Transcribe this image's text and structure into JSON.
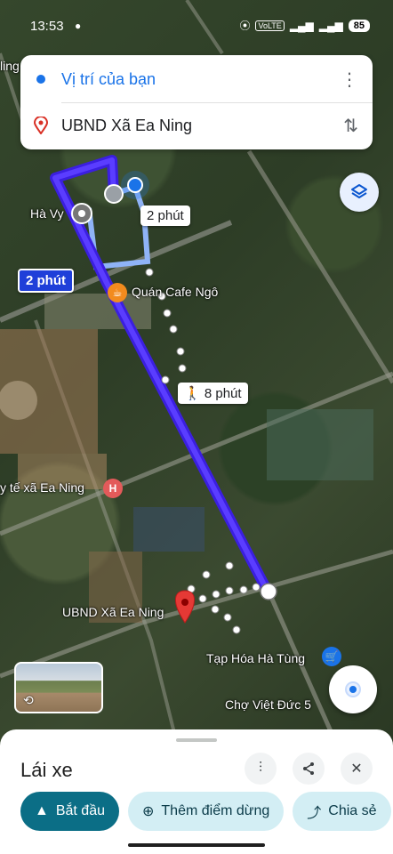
{
  "status_bar": {
    "time": "13:53",
    "message_icon": "chat-bubble-icon",
    "network_label": "VoLTE",
    "battery": "85"
  },
  "route_card": {
    "origin": "Vị trí của bạn",
    "destination": "UBND Xã Ea Ning",
    "more_icon": "more-vert-icon",
    "swap_icon": "swap-vert-icon"
  },
  "map": {
    "labels": {
      "ha_vy": "Hà Vy",
      "quan_cafe": "Quán Cafe Ngô",
      "y_te": "y tế xã Ea Ning",
      "ubnd": "UBND Xã Ea Ning",
      "tap_hoa": "Tạp Hóa Hà Tùng",
      "cho": "Chợ Việt Đức 5",
      "ling": "ling"
    },
    "time_chips": {
      "alt_route": "2 phút",
      "selected_route": "2 phút",
      "walking": "8 phút"
    },
    "route_color": "#3b1fe0",
    "selected_chip_color": "#1f3fd9"
  },
  "bottom_sheet": {
    "mode_title": "Lái xe",
    "actions": {
      "start": "Bắt đầu",
      "add_stop": "Thêm điểm dừng",
      "share": "Chia sẻ"
    },
    "icons": [
      "tune-icon",
      "share-icon",
      "close-icon"
    ]
  }
}
